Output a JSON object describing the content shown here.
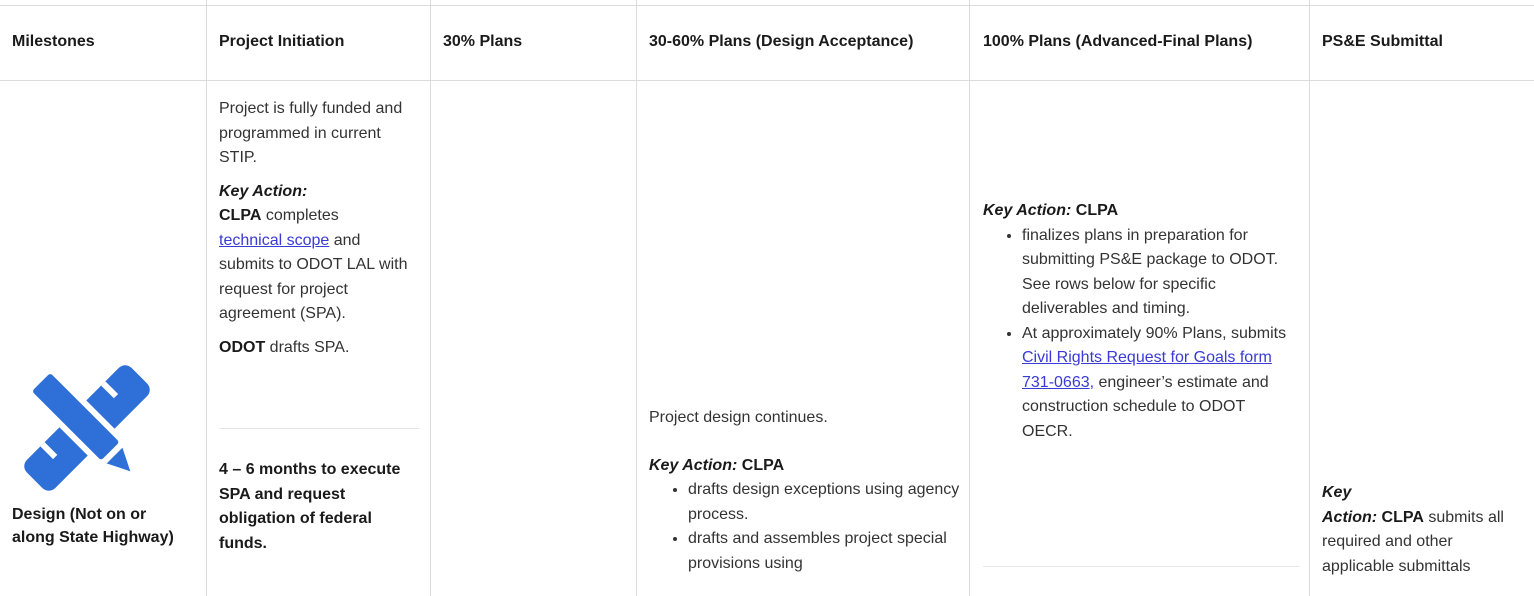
{
  "headers": {
    "milestones": "Milestones",
    "project_initiation": "Project Initiation",
    "plans_30": "30% Plans",
    "plans_30_60": "30-60% Plans (Design Acceptance)",
    "plans_100": "100% Plans (Advanced-Final Plans)",
    "pse_submittal": "PS&E Submittal"
  },
  "milestone": {
    "icon": "pencil-ruler-icon",
    "label": "Design (Not on or along State Highway)"
  },
  "initiation": {
    "funded": "Project is fully funded and programmed in current STIP.",
    "key_action": "Key Action:",
    "clpa": "CLPA",
    "completes": " completes",
    "tech_scope_link": "technical scope",
    "and_submits": " and submits to ODOT LAL with request for project agreement (SPA).",
    "odot": "ODOT",
    "drafts_spa": " drafts SPA.",
    "timeline": "4 – 6 months to execute SPA and request obligation of federal funds."
  },
  "plans_30_60": {
    "continues": "Project design continues.",
    "key_action": "Key Action:",
    "clpa": " CLPA",
    "bullets": [
      "drafts design exceptions using agency process.",
      "drafts and assembles project special provisions using"
    ]
  },
  "plans_100": {
    "key_action": "Key Action:",
    "clpa": " CLPA",
    "bullet1": "finalizes plans in preparation for submitting PS&E package to ODOT.  See rows below for specific deliverables and timing.",
    "bullet2_pre": "At approximately 90% Plans, submits ",
    "bullet2_link": "Civil Rights Request for Goals form 731-0663,",
    "bullet2_post": " engineer’s estimate and construction schedule to ODOT OECR."
  },
  "pse": {
    "key": "Key",
    "action": "Action:",
    "clpa": " CLPA",
    "text": "  submits all required and other applicable submittals"
  },
  "colors": {
    "icon_blue": "#2f6fd8",
    "link": "#3a3ad6",
    "border": "#dcdcdc"
  }
}
